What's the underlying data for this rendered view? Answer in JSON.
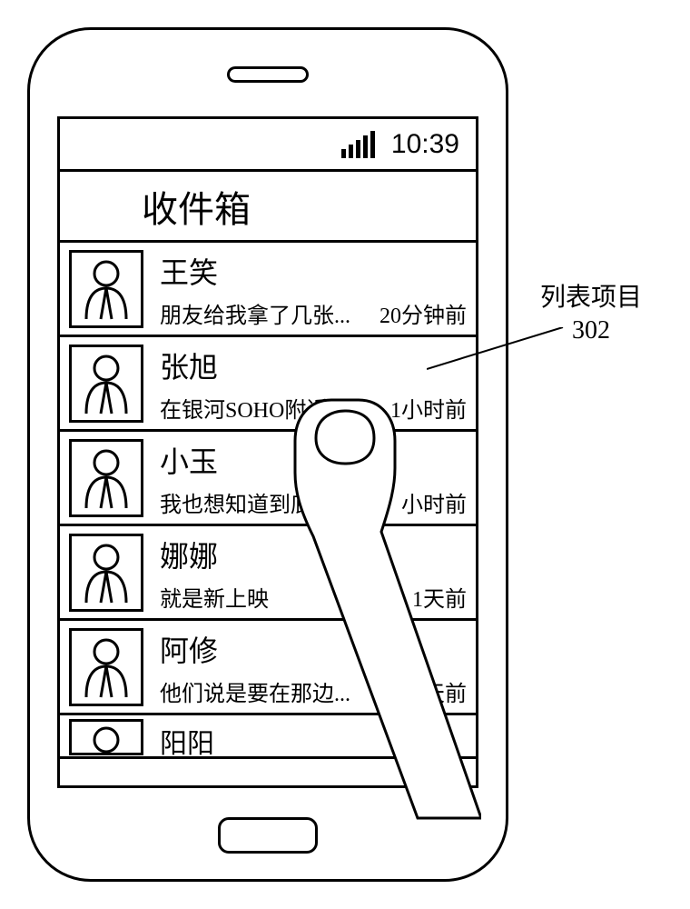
{
  "statusbar": {
    "time": "10:39"
  },
  "title": "收件箱",
  "messages": [
    {
      "name": "王笑",
      "snippet": "朋友给我拿了几张...",
      "time": "20分钟前"
    },
    {
      "name": "张旭",
      "snippet": "在银河SOHO附近...",
      "time": "1小时前"
    },
    {
      "name": "小玉",
      "snippet": "我也想知道到底",
      "time": "小时前"
    },
    {
      "name": "娜娜",
      "snippet": "就是新上映",
      "time": "1天前"
    },
    {
      "name": "阿修",
      "snippet": "他们说是要在那边...",
      "time": "3天前"
    },
    {
      "name": "阳阳",
      "snippet": "",
      "time": ""
    }
  ],
  "annotation": {
    "label": "列表项目",
    "ref": "302"
  }
}
